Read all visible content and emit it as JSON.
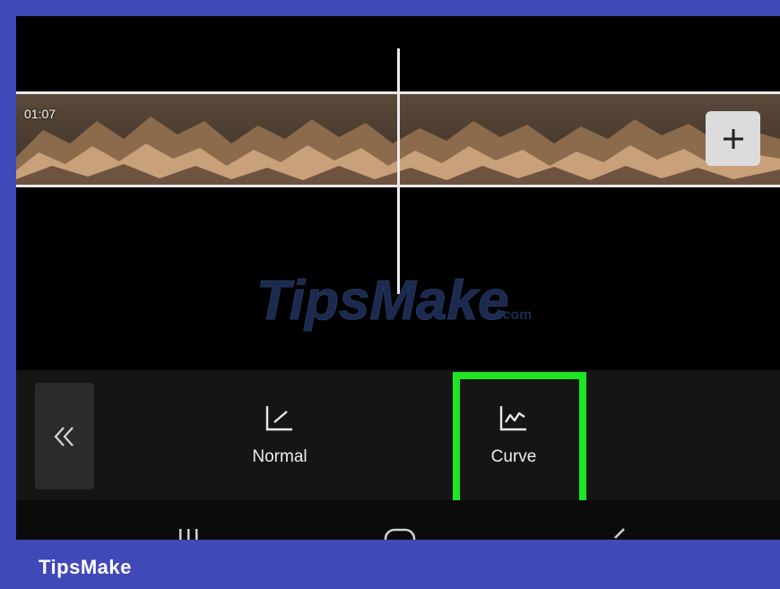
{
  "timeline": {
    "timestamp": "01:07",
    "add_clip_icon": "plus-icon"
  },
  "watermark": {
    "text": "TipsMake",
    "suffix": ".com"
  },
  "speed_panel": {
    "collapse_icon": "double-chevron-left-icon",
    "options": [
      {
        "label": "Normal",
        "icon": "linear-graph-icon"
      },
      {
        "label": "Curve",
        "icon": "curve-graph-icon",
        "highlighted": true
      }
    ],
    "highlight_color": "#1ee624"
  },
  "nav_bar": {
    "icons": [
      "recent-apps-icon",
      "home-icon",
      "back-icon"
    ]
  },
  "brand": {
    "label": "TipsMake",
    "color": "#4049b8"
  }
}
